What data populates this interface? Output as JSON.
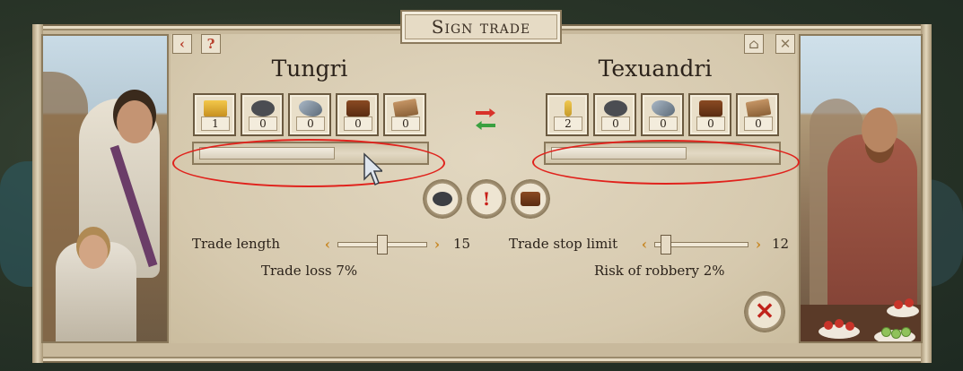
{
  "title": "Sign trade",
  "toolbar": {
    "back_icon": "‹",
    "help_icon": "?",
    "info_icon": "⌂",
    "close_icon": "✕"
  },
  "left": {
    "name": "Tungri",
    "resources": [
      {
        "icon": "gold-icon",
        "value": "1"
      },
      {
        "icon": "coal-icon",
        "value": "0"
      },
      {
        "icon": "iron-ore-icon",
        "value": "0"
      },
      {
        "icon": "wood-icon",
        "value": "0"
      },
      {
        "icon": "planks-icon",
        "value": "0"
      }
    ],
    "bar_fill": 0.6
  },
  "right": {
    "name": "Texuandri",
    "resources": [
      {
        "icon": "wheat-icon",
        "value": "2"
      },
      {
        "icon": "coal-icon",
        "value": "0"
      },
      {
        "icon": "iron-ore-icon",
        "value": "0"
      },
      {
        "icon": "wood-icon",
        "value": "0"
      },
      {
        "icon": "planks-icon",
        "value": "0"
      }
    ],
    "bar_fill": 0.6
  },
  "actions": {
    "excl": "!"
  },
  "trade_length": {
    "label": "Trade length",
    "value": "15",
    "fraction": 0.5
  },
  "trade_stop": {
    "label": "Trade stop limit",
    "value": "12",
    "fraction": 0.08
  },
  "trade_loss": "Trade loss 7%",
  "risk_robbery": "Risk of robbery 2%",
  "close_label": "✕",
  "colors": {
    "highlight": "#e0221c",
    "frame": "#8b7a5c",
    "panel": "#d6c9ae"
  }
}
